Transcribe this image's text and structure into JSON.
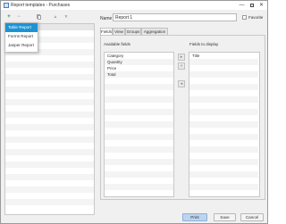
{
  "window": {
    "title": "Report templates - Purchases",
    "minimize_glyph": "—",
    "close_glyph": "✕"
  },
  "toolbar": {
    "add_glyph": "+",
    "remove_glyph": "−",
    "up_glyph": "▲",
    "down_glyph": "▼"
  },
  "dropdown": {
    "items": [
      "Table Report",
      "Forms Report",
      "Jasper Report"
    ],
    "selected": "Table Report"
  },
  "editor": {
    "name_label": "Name",
    "name_value": "Report 1",
    "favorite_label": "Favorite",
    "tabs": [
      "Fields",
      "View",
      "Groups",
      "Aggregation"
    ],
    "active_tab": "Fields"
  },
  "fields": {
    "available_label": "Available fields",
    "display_label": "Fields to display",
    "available": [
      "Category",
      "Quantity",
      "Price",
      "Total"
    ],
    "display": [
      "Title"
    ],
    "move_right_glyph": "▸",
    "move_all_right_glyph": "»",
    "move_left_glyph": "◂"
  },
  "buttons": {
    "print": "Print",
    "save": "Save",
    "cancel": "Cancel"
  },
  "colors": {
    "selection": "#1d93d3",
    "primary_button": "#bcd4ef",
    "add_icon": "#2e8b57"
  }
}
